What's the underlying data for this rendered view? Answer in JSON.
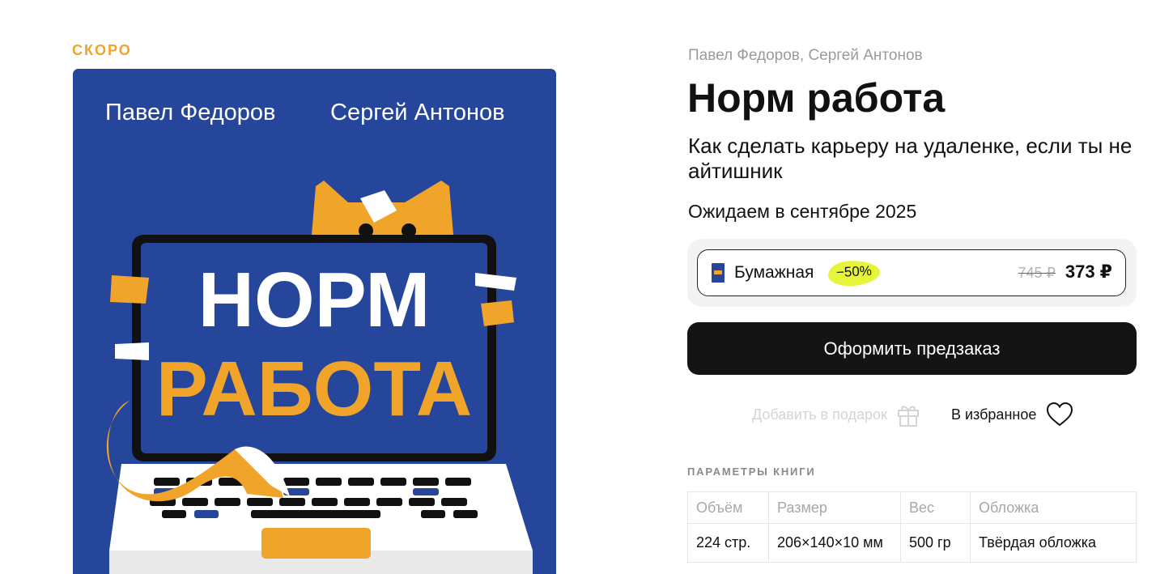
{
  "badge": "СКОРО",
  "cover": {
    "author_left": "Павел Федоров",
    "author_right": "Сергей Антонов",
    "title_line1": "НОРМ",
    "title_line2": "РАБОТА"
  },
  "book": {
    "authors": "Павел Федоров, Сергей Антонов",
    "title": "Норм работа",
    "subtitle": "Как сделать карьеру на удаленке, если ты не айтишник",
    "expected": "Ожидаем в сентябре 2025"
  },
  "format": {
    "label": "Бумажная",
    "discount": "−50%",
    "old_price": "745 ₽",
    "new_price": "373 ₽"
  },
  "actions": {
    "preorder": "Оформить предзаказ",
    "gift": "Добавить в подарок",
    "favorite": "В избранное"
  },
  "params": {
    "title": "ПАРАМЕТРЫ КНИГИ",
    "headers": [
      "Объём",
      "Размер",
      "Вес",
      "Обложка"
    ],
    "values": [
      "224 стр.",
      "206×140×10 мм",
      "500 гр",
      "Твёрдая обложка"
    ]
  },
  "colors": {
    "accent_orange": "#f0a42a",
    "cover_blue": "#25469a",
    "discount_highlight": "#e6f53a",
    "button_dark": "#141414"
  }
}
